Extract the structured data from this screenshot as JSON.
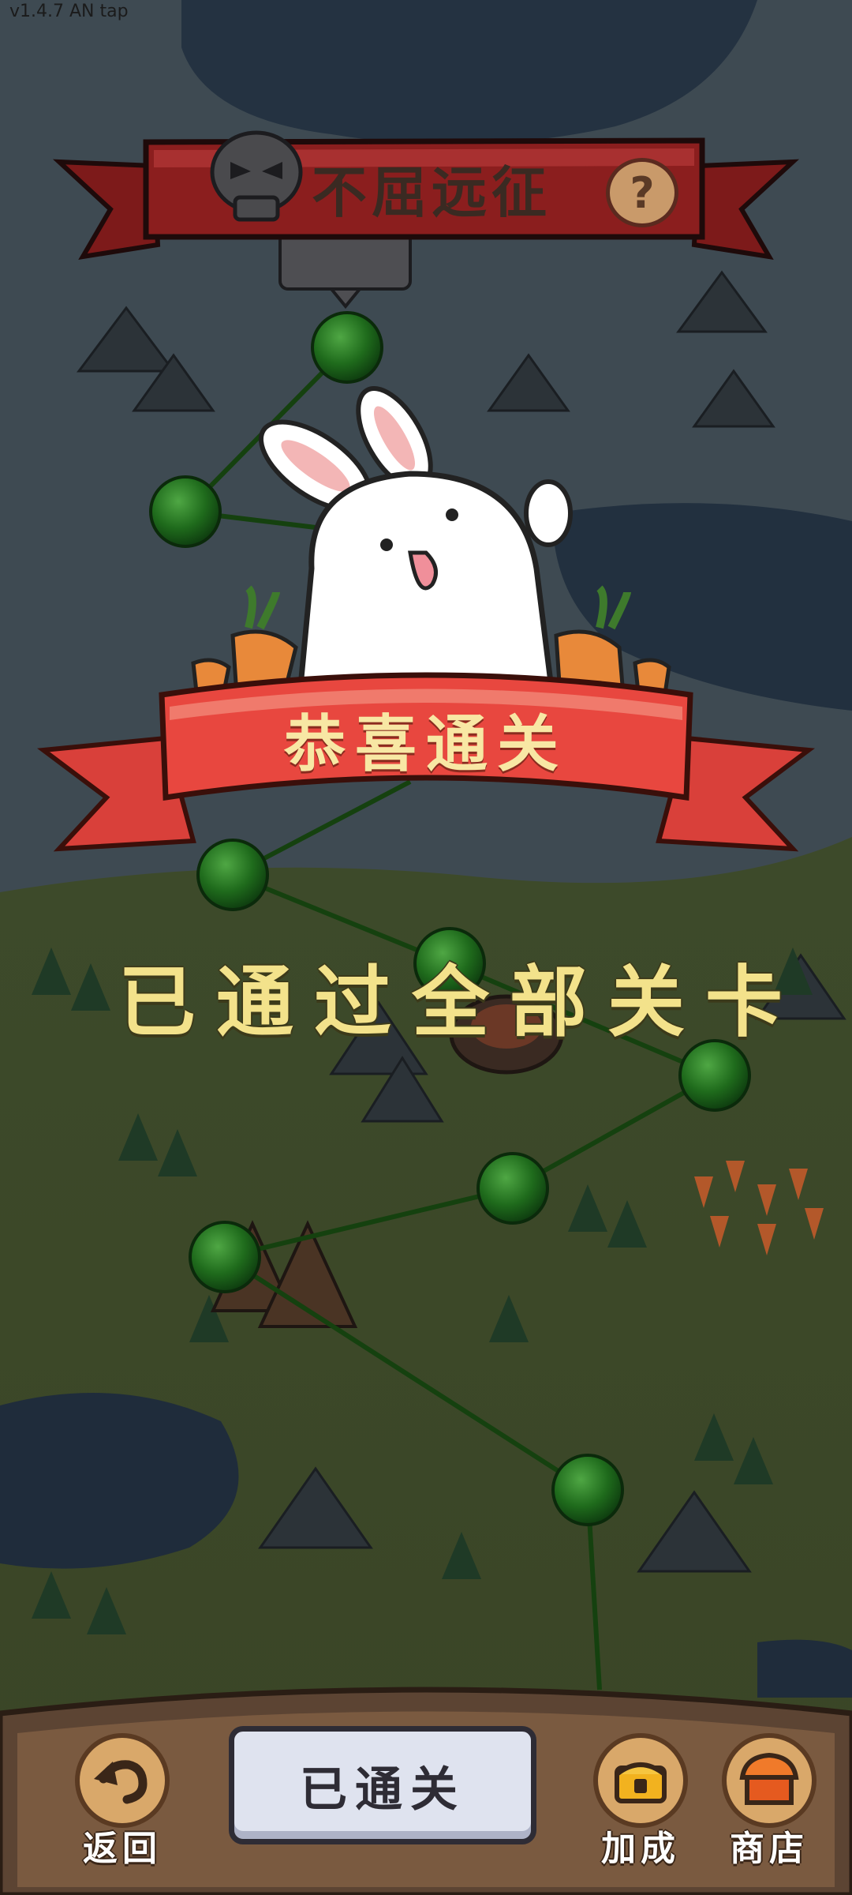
{
  "version_label": "v1.4.7 AN tap",
  "header": {
    "title": "不屈远征",
    "help_icon_text": "?"
  },
  "banner": {
    "congrats": "恭喜通关"
  },
  "message": "已通过全部关卡",
  "bottom": {
    "back_label": "返回",
    "status_button_label": "已通关",
    "bonus_label": "加成",
    "shop_label": "商店"
  },
  "colors": {
    "map_dark_overlay": "#2b3a3c",
    "level_node": "#1f6b1c",
    "banner_red": "#e8473f",
    "title_red": "#8b1e1e",
    "text_yellow": "#f3e28b"
  }
}
